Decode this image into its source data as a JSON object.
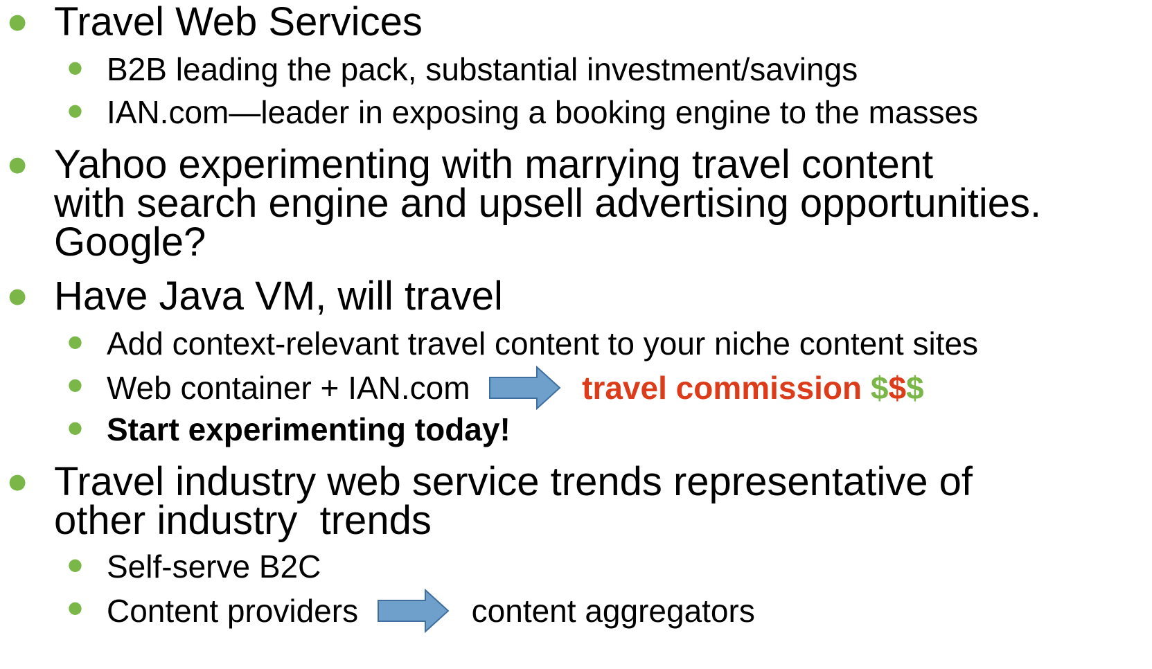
{
  "bullets": [
    {
      "text": "Travel Web Services",
      "children": [
        "B2B leading the pack, substantial investment/savings",
        "IAN.com—leader in exposing a booking engine to the masses"
      ]
    },
    {
      "lines": [
        "Yahoo experimenting with marrying travel content",
        "with search engine and upsell advertising opportunities.",
        "Google?"
      ]
    },
    {
      "text": "Have Java VM, will travel",
      "children": [
        "Add context-relevant travel content to your niche content sites",
        {
          "left": "Web container + IAN.com",
          "right_red": "travel commission",
          "right_green_1": "$",
          "right_red_2": "$",
          "right_green_3": "$"
        },
        "Start experimenting today!"
      ]
    },
    {
      "lines": [
        "Travel industry web service trends representative of",
        "other industry  trends"
      ],
      "children": [
        "Self-serve B2C",
        {
          "left": "Content providers",
          "right": "content aggregators"
        }
      ]
    }
  ],
  "colors": {
    "bullet": "#7ab648",
    "accent_red": "#dc3c1a",
    "accent_green": "#7ab648",
    "arrow_fill": "#6f9fcb",
    "arrow_stroke": "#3f6f9f"
  },
  "icons": {
    "bullet": "dot",
    "arrow": "right-block-arrow-icon"
  }
}
